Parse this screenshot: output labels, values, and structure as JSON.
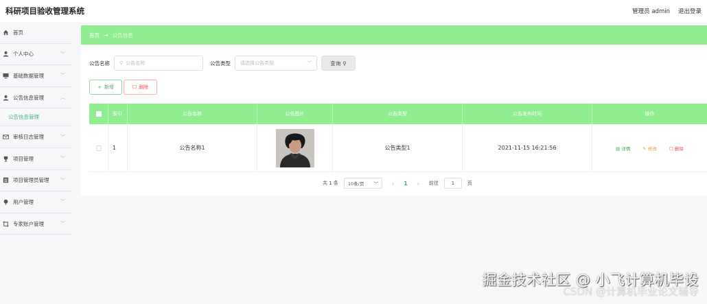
{
  "header": {
    "app_title": "科研项目验收管理系统",
    "user_label": "管理员 admin",
    "logout_label": "退出登录"
  },
  "sidebar": {
    "items": [
      {
        "label": "首页",
        "icon": "home-icon",
        "has_chevron": false
      },
      {
        "label": "个人中心",
        "icon": "user-icon",
        "has_chevron": true
      },
      {
        "label": "基础数据管理",
        "icon": "monitor-icon",
        "has_chevron": true
      },
      {
        "label": "公告信息管理",
        "icon": "user-icon",
        "has_chevron": true,
        "expanded": true
      },
      {
        "label": "审核日志管理",
        "icon": "mail-icon",
        "has_chevron": true
      },
      {
        "label": "项目管理",
        "icon": "trophy-icon",
        "has_chevron": true
      },
      {
        "label": "项目管理员管理",
        "icon": "list-icon",
        "has_chevron": true
      },
      {
        "label": "用户管理",
        "icon": "pin-icon",
        "has_chevron": true
      },
      {
        "label": "专家账户管理",
        "icon": "crop-icon",
        "has_chevron": true
      }
    ],
    "subitem": "公告信息管理"
  },
  "breadcrumb": {
    "home": "首页",
    "current": "公告信息"
  },
  "search": {
    "name_label": "公告名称",
    "name_placeholder": "公告名称",
    "type_label": "公告类型",
    "type_placeholder": "请选择公告类型",
    "query_label": "查询"
  },
  "actions": {
    "add_label": "新增",
    "delete_label": "删除"
  },
  "table": {
    "headers": [
      "索引",
      "公告名称",
      "公告图片",
      "公告类型",
      "公告发布时间",
      "操作"
    ],
    "rows": [
      {
        "index": "1",
        "name": "公告名称1",
        "type": "公告类型1",
        "time": "2021-11-15 16:21:56"
      }
    ],
    "ops": {
      "detail": "详情",
      "edit": "修改",
      "delete": "删除"
    }
  },
  "pagination": {
    "total": "共 1 条",
    "page_size": "10条/页",
    "current_page": "1",
    "goto_label": "前往",
    "goto_value": "1",
    "page_suffix": "页"
  },
  "watermark": {
    "line1": "掘金技术社区 @ 小飞计算机毕设",
    "line2": "CSDN @计算机毕业论文辅导"
  },
  "colors": {
    "accent_green": "#90ee90",
    "detail_green": "#3aa85a",
    "edit_orange": "#e6a23c",
    "danger_red": "#e05555"
  }
}
